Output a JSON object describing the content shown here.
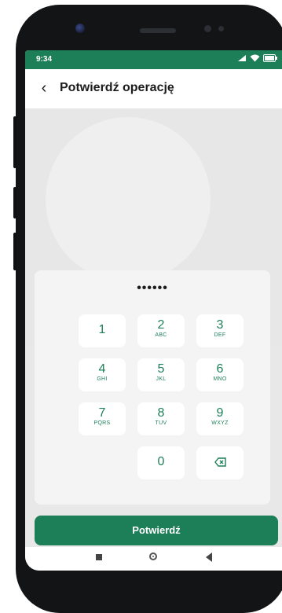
{
  "status_bar": {
    "time": "9:34"
  },
  "app_bar": {
    "back_icon": "chevron-left-icon",
    "title": "Potwierdź operację"
  },
  "pin": {
    "masked_value": "••••••"
  },
  "keypad": {
    "keys": [
      {
        "num": "1",
        "letters": ""
      },
      {
        "num": "2",
        "letters": "ABC"
      },
      {
        "num": "3",
        "letters": "DEF"
      },
      {
        "num": "4",
        "letters": "GHI"
      },
      {
        "num": "5",
        "letters": "JKL"
      },
      {
        "num": "6",
        "letters": "MNO"
      },
      {
        "num": "7",
        "letters": "PQRS"
      },
      {
        "num": "8",
        "letters": "TUV"
      },
      {
        "num": "9",
        "letters": "WXYZ"
      },
      {
        "num": "0",
        "letters": ""
      }
    ],
    "backspace_icon": "backspace-icon"
  },
  "confirm_button": {
    "label": "Potwierdź"
  },
  "colors": {
    "accent": "#1d7f58",
    "background": "#e7e8e7"
  }
}
